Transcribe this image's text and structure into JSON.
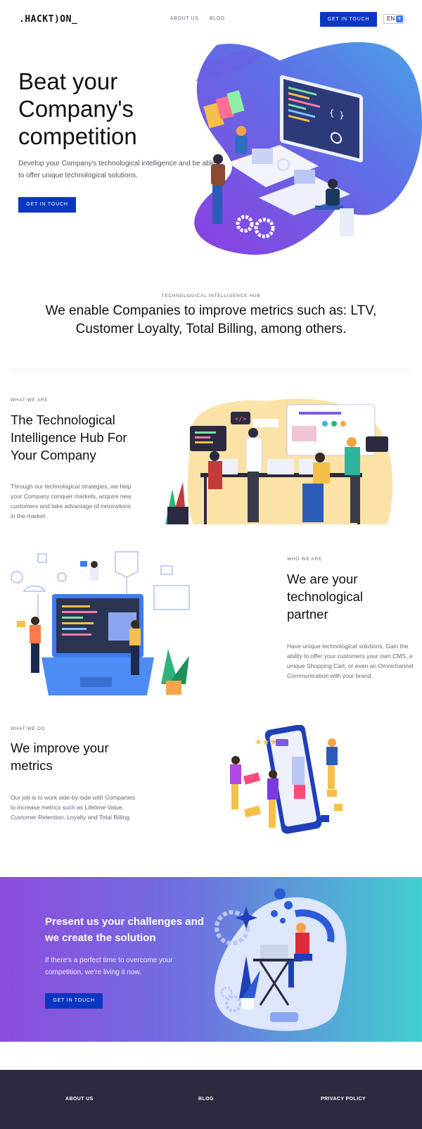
{
  "brand": {
    "logo": ".HACKT)ON_"
  },
  "nav": {
    "items": [
      {
        "label": "ABOUT US"
      },
      {
        "label": "BLOG"
      }
    ],
    "cta_label": "GET IN TOUCH",
    "language": "EN"
  },
  "hero": {
    "title": "Beat your Company's competition",
    "text": "Develop your Company's technological intelligence and be able to offer unique technological solutions.",
    "cta_label": "GET IN TOUCH"
  },
  "hub": {
    "kicker": "TECHNOLOGICAL INTELLIGENCE HUB",
    "title": "We enable Companies to improve metrics such as: LTV, Customer Loyalty, Total Billing, among others."
  },
  "what_we_are": {
    "kicker": "WHAT WE ARE",
    "title": "The Technological Intelligence Hub For Your Company",
    "text": "Through our technological strategies, we help your Company conquer markets, acquire new customers and take advantage of innovations in the market."
  },
  "who_we_are": {
    "kicker": "WHO WE ARE",
    "title": "We are your technological partner",
    "text": "Have unique technological solutions. Gain the ability to offer your customers your own CMS, a unique Shopping Cart, or even an Omnichannel Communication with your brand."
  },
  "what_we_do": {
    "kicker": "WHAT WE DO",
    "title": "We improve your metrics",
    "text": "Our job is to work side-by-side with Companies to increase metrics such as Lifetime Value, Customer Retention, Loyalty and Total Billing."
  },
  "cta_band": {
    "title": "Present us your challenges and we create the solution",
    "text": "If there's a perfect time to overcome your competition, we're living it now.",
    "cta_label": "GET IN TOUCH"
  },
  "footer": {
    "links": [
      {
        "label": "ABOUT US"
      },
      {
        "label": "BLOG"
      },
      {
        "label": "PRIVACY POLICY"
      }
    ]
  },
  "colors": {
    "primary": "#0a37c2",
    "footer_bg": "#2b2a40",
    "cta_from": "#8c4cdd",
    "cta_to": "#41cfd0"
  }
}
